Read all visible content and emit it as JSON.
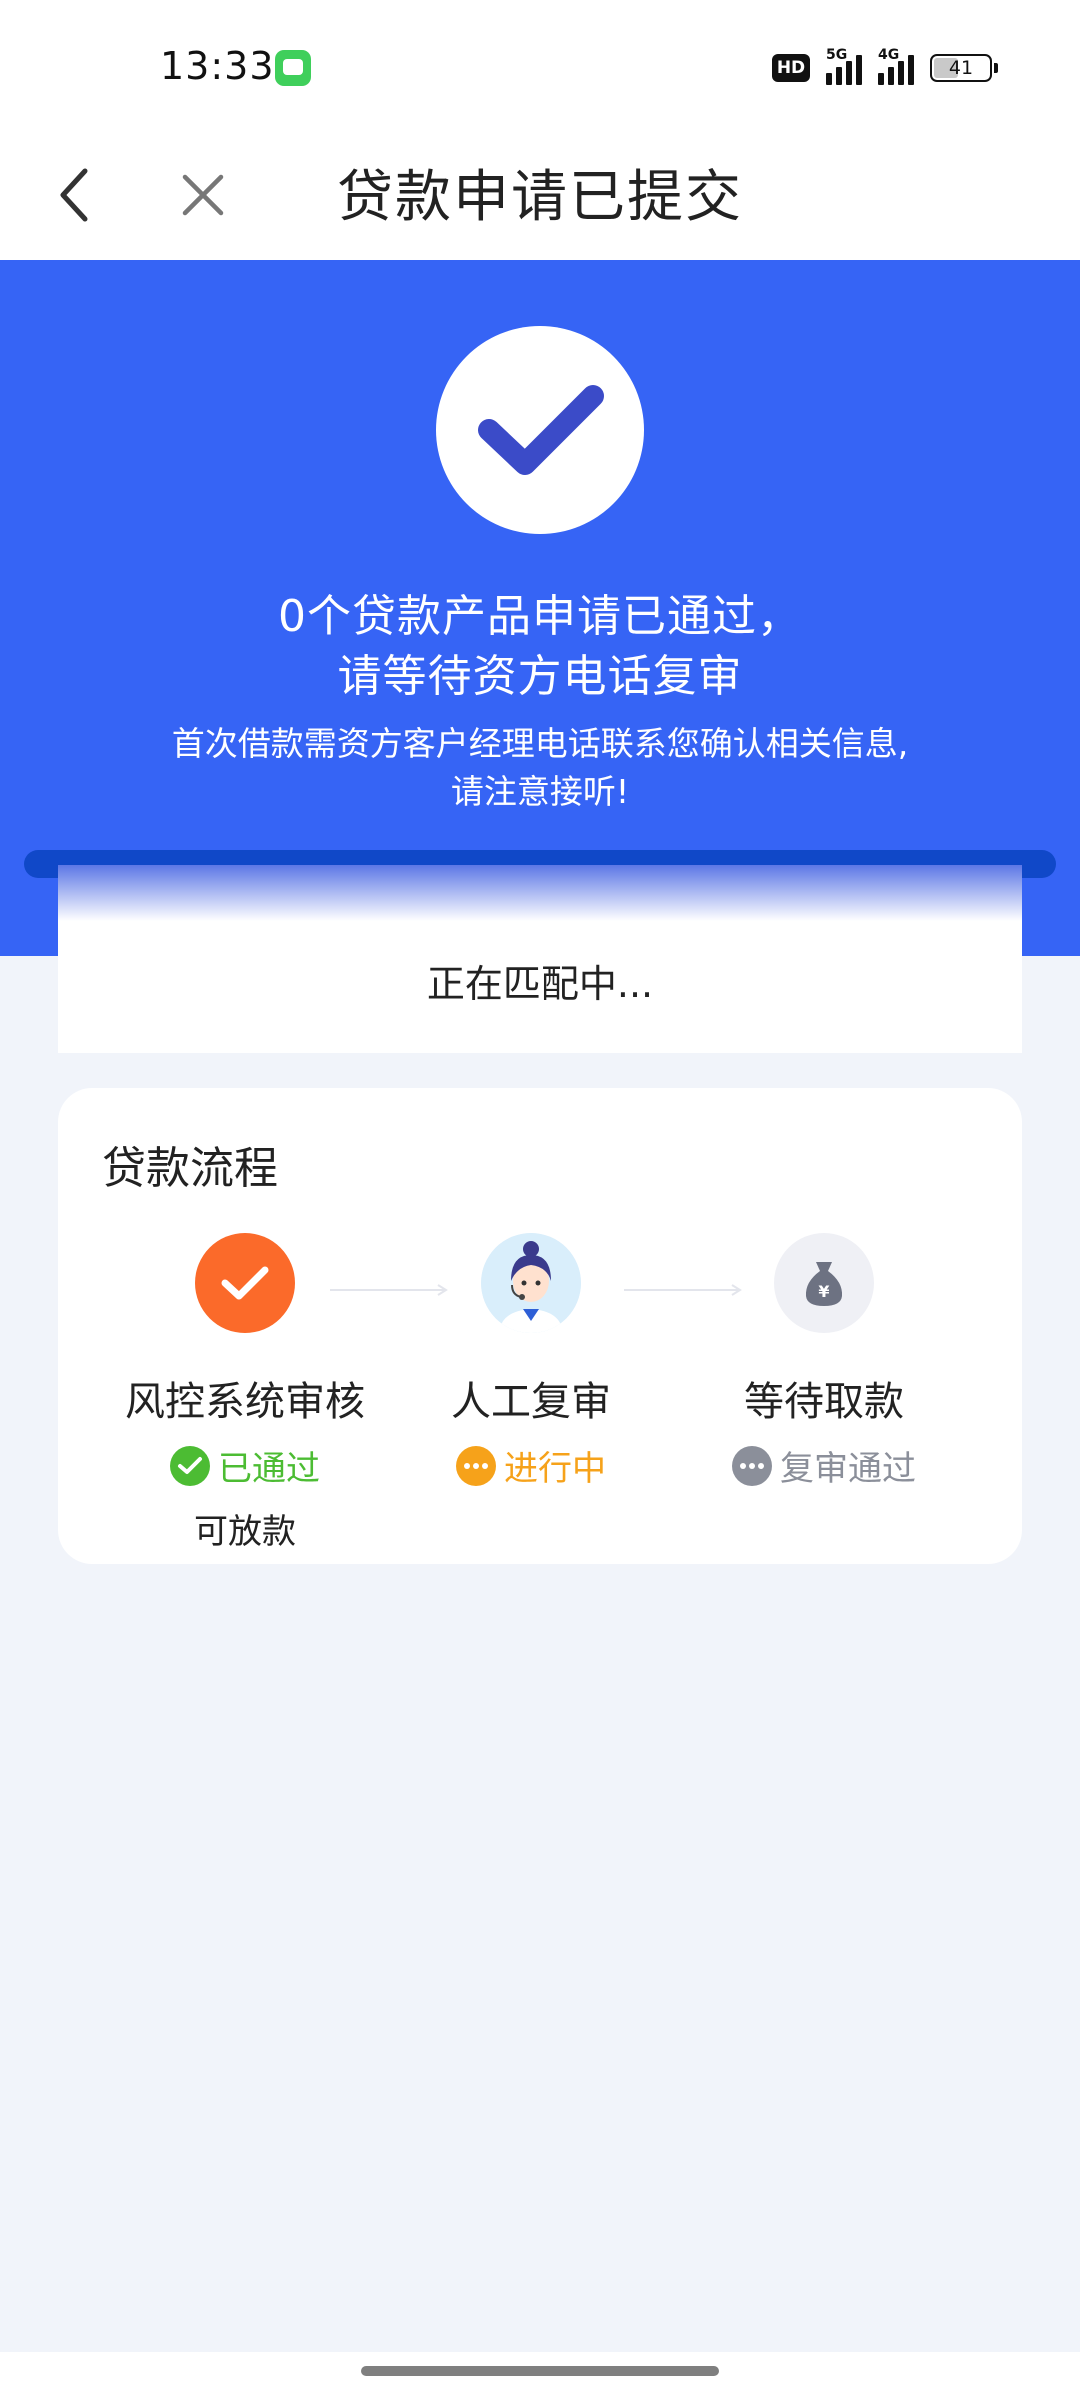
{
  "status_bar": {
    "time": "13:33",
    "message_icon": "message-app-icon",
    "hd": "HD",
    "network_1": "5G",
    "network_2": "4G",
    "battery": "41"
  },
  "navbar": {
    "back_icon": "chevron-left-icon",
    "close_icon": "close-icon",
    "title": "贷款申请已提交"
  },
  "hero": {
    "icon": "check-icon",
    "title_line1": "0个贷款产品申请已通过，",
    "title_line2": "请等待资方电话复审",
    "subtitle_line1": "首次借款需资方客户经理电话联系您确认相关信息,",
    "subtitle_line2": "请注意接听!",
    "background_color": "#3664f5"
  },
  "matching": {
    "text": "正在匹配中..."
  },
  "process": {
    "title": "贷款流程",
    "steps": [
      {
        "name": "风控系统审核",
        "icon": "check-icon",
        "status": "已通过",
        "status_icon": "check-circle-icon",
        "status_color": "#4cbc33",
        "note": "可放款"
      },
      {
        "name": "人工复审",
        "icon": "customer-service-agent-icon",
        "status": "进行中",
        "status_icon": "more-dots-icon",
        "status_color": "#f6a21a"
      },
      {
        "name": "等待取款",
        "icon": "money-bag-icon",
        "status": "复审通过",
        "status_icon": "more-dots-icon",
        "status_color": "#8b8f9a"
      }
    ]
  }
}
